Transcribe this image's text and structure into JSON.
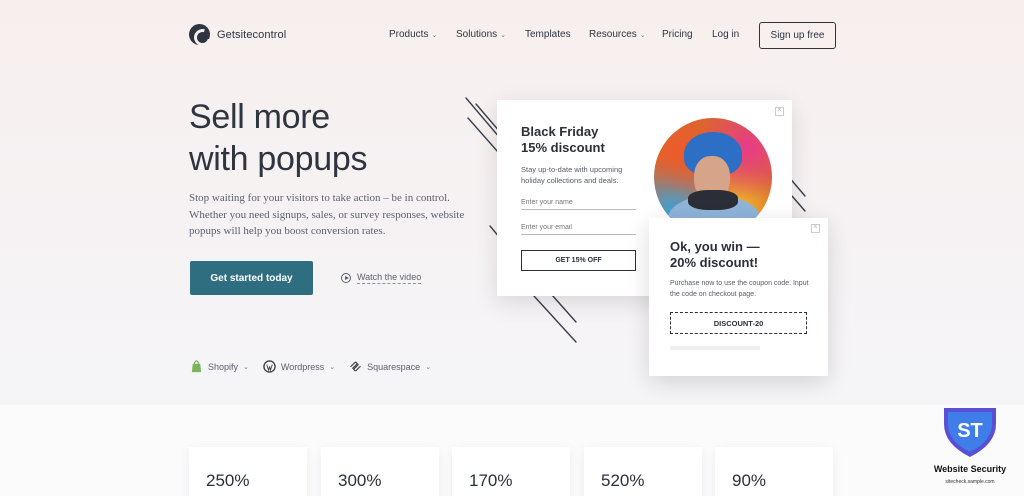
{
  "header": {
    "brand": "Getsitecontrol",
    "nav": [
      {
        "label": "Products",
        "chevron": true
      },
      {
        "label": "Solutions",
        "chevron": true
      },
      {
        "label": "Templates",
        "chevron": false
      },
      {
        "label": "Resources",
        "chevron": true
      },
      {
        "label": "Pricing",
        "chevron": false
      },
      {
        "label": "Log in",
        "chevron": false
      }
    ],
    "signup": "Sign up free"
  },
  "hero": {
    "title_line1": "Sell more",
    "title_line2": "with popups",
    "subtitle": "Stop waiting for your visitors to take action – be in control. Whether you need signups, sales, or survey responses, website popups will help you boost conversion rates.",
    "cta": "Get started today",
    "watch": "Watch the video"
  },
  "integrations": [
    {
      "label": "Shopify",
      "icon": "shopify-icon"
    },
    {
      "label": "Wordpress",
      "icon": "wordpress-icon"
    },
    {
      "label": "Squarespace",
      "icon": "squarespace-icon"
    }
  ],
  "popup1": {
    "title_line1": "Black Friday",
    "title_line2": "15% discount",
    "text": "Stay up-to-date with upcoming holiday collections and deals.",
    "field1_placeholder": "Enter your name",
    "field2_placeholder": "Enter your email",
    "button": "GET 15% OFF"
  },
  "popup2": {
    "title_line1": "Ok, you win —",
    "title_line2": "20% discount!",
    "text": "Purchase now to use the coupon code. Input the code on checkout page.",
    "code": "DISCOUNT-20"
  },
  "stats": [
    "250%",
    "300%",
    "170%",
    "520%",
    "90%"
  ],
  "badge": {
    "title": "Website Security",
    "url": "sitecheck.sample.com",
    "monogram": "ST"
  },
  "colors": {
    "accent": "#2f6e80",
    "text_dark": "#2e3440"
  }
}
